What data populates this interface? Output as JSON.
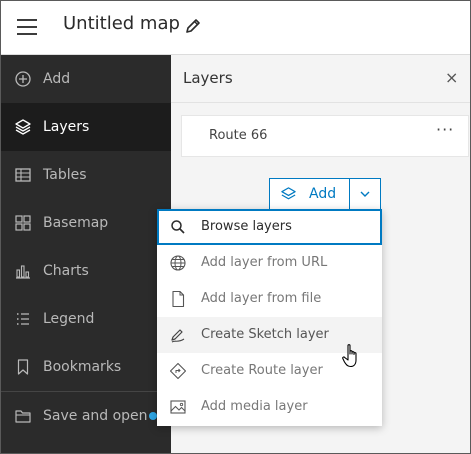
{
  "header": {
    "map_title": "Untitled map",
    "menu_icon": "hamburger-menu-icon",
    "edit_icon": "pencil-icon"
  },
  "sidebar": {
    "items": [
      {
        "label": "Add",
        "icon": "plus-circle-icon",
        "active": false
      },
      {
        "label": "Layers",
        "icon": "layers-icon",
        "active": true
      },
      {
        "label": "Tables",
        "icon": "table-icon",
        "active": false
      },
      {
        "label": "Basemap",
        "icon": "basemap-grid-icon",
        "active": false
      },
      {
        "label": "Charts",
        "icon": "bar-chart-icon",
        "active": false
      },
      {
        "label": "Legend",
        "icon": "legend-list-icon",
        "active": false
      },
      {
        "label": "Bookmarks",
        "icon": "bookmark-icon",
        "active": false
      },
      {
        "label": "Save and open",
        "icon": "folder-icon",
        "active": false
      }
    ]
  },
  "panel": {
    "title": "Layers",
    "close_glyph": "×",
    "layers": [
      {
        "name": "Route 66",
        "more_glyph": "···"
      }
    ],
    "add_button": {
      "label": "Add",
      "icon": "layers-add-icon",
      "chevron_icon": "chevron-down-icon"
    }
  },
  "add_menu": {
    "items": [
      {
        "label": "Browse layers",
        "icon": "search-icon",
        "state": "focused"
      },
      {
        "label": "Add layer from URL",
        "icon": "globe-icon",
        "state": "normal"
      },
      {
        "label": "Add layer from file",
        "icon": "file-icon",
        "state": "normal"
      },
      {
        "label": "Create Sketch layer",
        "icon": "sketch-pen-icon",
        "state": "hover"
      },
      {
        "label": "Create Route layer",
        "icon": "route-diamond-icon",
        "state": "normal"
      },
      {
        "label": "Add media layer",
        "icon": "image-icon",
        "state": "normal"
      }
    ]
  },
  "colors": {
    "accent": "#007ac2",
    "sidebar_bg": "#2b2b2b",
    "sidebar_active": "#1c1c1c",
    "notification_dot": "#2da6e6"
  }
}
